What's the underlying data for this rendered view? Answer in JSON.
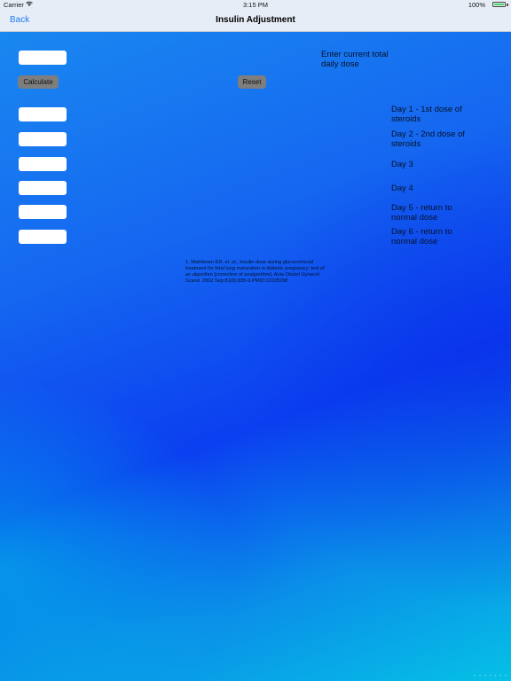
{
  "status_bar": {
    "carrier": "Carrier",
    "time": "3:15 PM",
    "battery": "100%"
  },
  "nav": {
    "back_label": "Back",
    "title": "Insulin Adjustment"
  },
  "buttons": {
    "calculate": "Calculate",
    "reset": "Reset"
  },
  "labels": {
    "total_dose": "Enter current total\ndaily dose",
    "day1": "Day 1 - 1st dose of\nsteroids",
    "day2": "Day 2 - 2nd dose of\nsteroids",
    "day3": "Day 3",
    "day4": "Day 4",
    "day5": "Day 5 - return to\nnormal dose",
    "day6": "Day 6 - return to\nnormal dose"
  },
  "fields": {
    "total_dose": "",
    "day1": "",
    "day2": "",
    "day3": "",
    "day4": "",
    "day5": "",
    "day6": ""
  },
  "reference": "1. Mathiesen ER, et. al., Insulin dose during glucocorticoid treatment for fetal lung maturation in diabetic pregnancy: test of an algorithm [correction of analgorithm]. Acta Obstet Gynecol Scand. 2002 Sep;81(9):835-9.PMID:12225298",
  "colors": {
    "accent": "#1a7cf5",
    "battery": "#4cd964",
    "button_bg": "#7e7e7e",
    "bar_bg": "#e7edf6"
  }
}
